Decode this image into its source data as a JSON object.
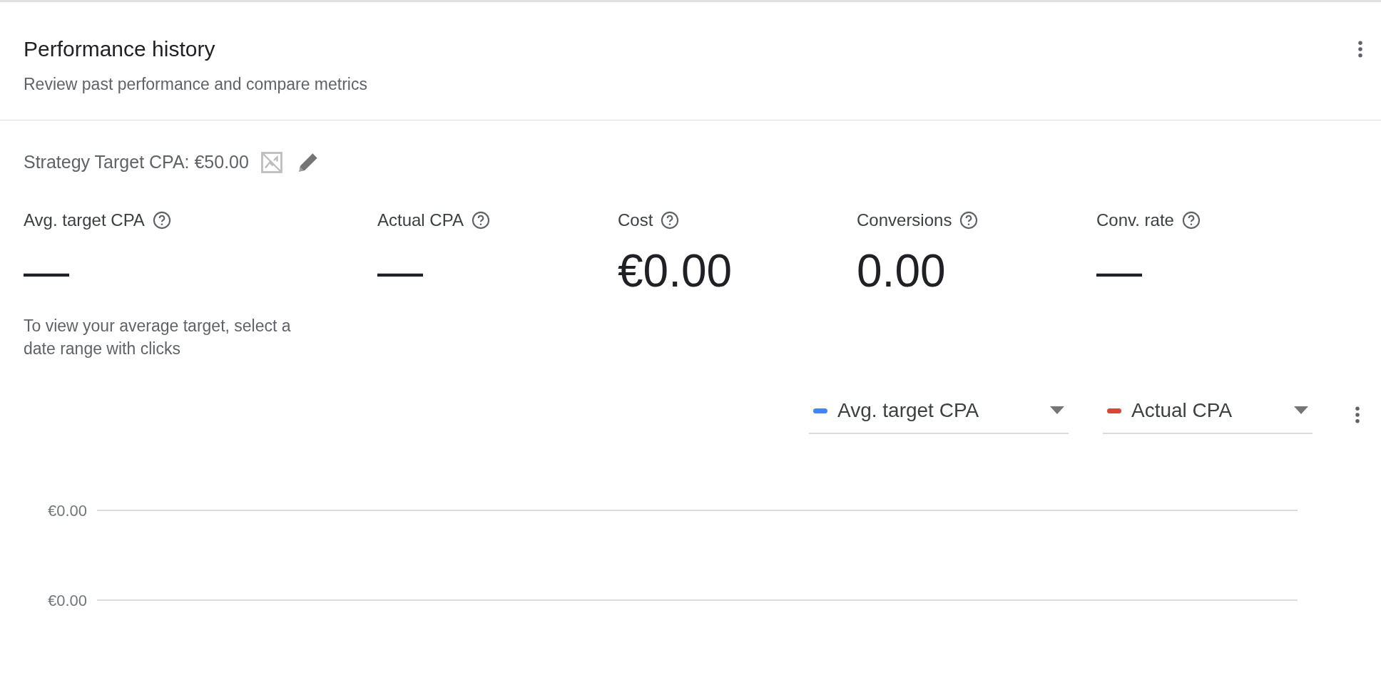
{
  "header": {
    "title": "Performance history",
    "subtitle": "Review past performance and compare metrics"
  },
  "strategy": {
    "label": "Strategy Target CPA: €50.00"
  },
  "metrics": [
    {
      "label": "Avg. target CPA",
      "value": "—",
      "note": "To view your average target, select a date range with clicks"
    },
    {
      "label": "Actual CPA",
      "value": "—"
    },
    {
      "label": "Cost",
      "value": "€0.00"
    },
    {
      "label": "Conversions",
      "value": "0.00"
    },
    {
      "label": "Conv. rate",
      "value": "—"
    }
  ],
  "legend": [
    {
      "label": "Avg. target CPA",
      "color": "#4285f4"
    },
    {
      "label": "Actual CPA",
      "color": "#db4437"
    }
  ],
  "chart": {
    "y_axis_labels": [
      "€0.00",
      "€0.00"
    ]
  }
}
